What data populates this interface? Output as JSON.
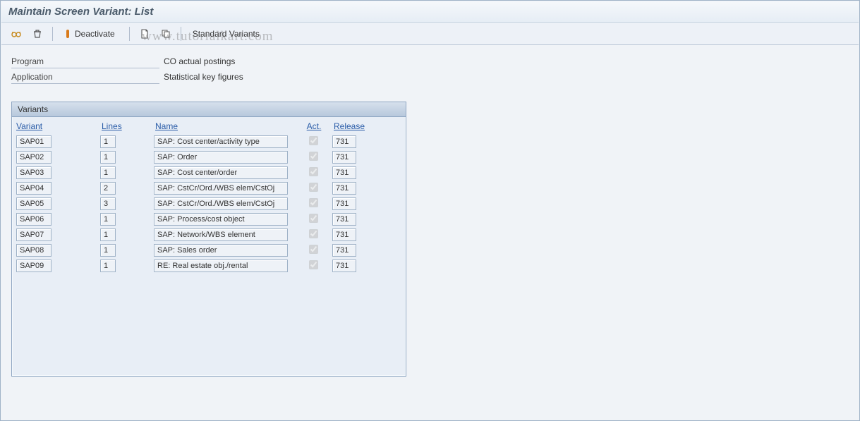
{
  "title": "Maintain Screen Variant: List",
  "toolbar": {
    "deactivate": "Deactivate",
    "standard_variants": "Standard Variants"
  },
  "form": {
    "program_label": "Program",
    "program_value": "CO actual postings",
    "application_label": "Application",
    "application_value": "Statistical key figures"
  },
  "panel": {
    "title": "Variants",
    "columns": {
      "variant": "Variant",
      "lines": "Lines",
      "name": "Name",
      "act": "Act.",
      "release": "Release"
    },
    "rows": [
      {
        "variant": "SAP01",
        "lines": "1",
        "name": "SAP: Cost center/activity type",
        "act": true,
        "release": "731"
      },
      {
        "variant": "SAP02",
        "lines": "1",
        "name": "SAP: Order",
        "act": true,
        "release": "731"
      },
      {
        "variant": "SAP03",
        "lines": "1",
        "name": "SAP: Cost center/order",
        "act": true,
        "release": "731"
      },
      {
        "variant": "SAP04",
        "lines": "2",
        "name": "SAP: CstCr/Ord./WBS elem/CstOj",
        "act": true,
        "release": "731"
      },
      {
        "variant": "SAP05",
        "lines": "3",
        "name": "SAP: CstCr/Ord./WBS elem/CstOj",
        "act": true,
        "release": "731"
      },
      {
        "variant": "SAP06",
        "lines": "1",
        "name": "SAP: Process/cost object",
        "act": true,
        "release": "731"
      },
      {
        "variant": "SAP07",
        "lines": "1",
        "name": "SAP: Network/WBS element",
        "act": true,
        "release": "731"
      },
      {
        "variant": "SAP08",
        "lines": "1",
        "name": "SAP: Sales order",
        "act": true,
        "release": "731"
      },
      {
        "variant": "SAP09",
        "lines": "1",
        "name": "RE: Real estate obj./rental",
        "act": true,
        "release": "731"
      }
    ]
  },
  "watermark": "www.tutorialkart.com"
}
